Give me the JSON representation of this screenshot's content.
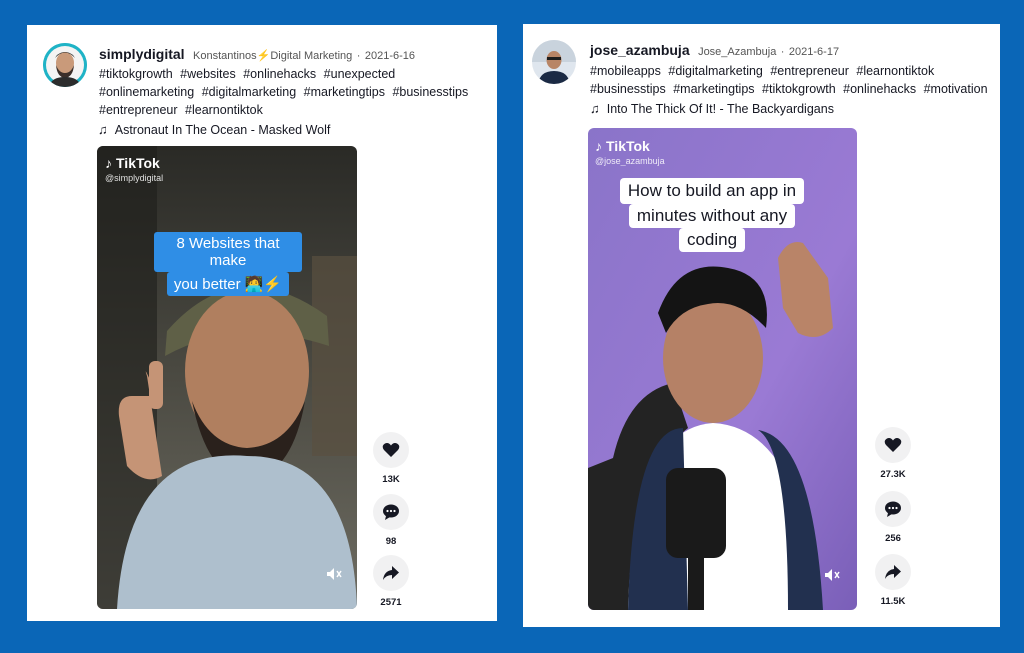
{
  "colors": {
    "frame": "#0a66b7",
    "caption_blue": "#2f8ee6"
  },
  "posts": [
    {
      "username": "simplydigital",
      "display": "Konstantinos",
      "badge": "⚡",
      "role": "Digital Marketing",
      "separator": "·",
      "date": "2021-6-16",
      "hashtags": [
        "#tiktokgrowth",
        "#websites",
        "#onlinehacks",
        "#unexpected",
        "#onlinemarketing",
        "#digitalmarketing",
        "#marketingtips",
        "#businesstips",
        "#entrepreneur",
        "#learnontiktok"
      ],
      "music": "Astronaut In The Ocean - Masked Wolf",
      "watermark": {
        "logo": "TikTok",
        "handle": "@simplydigital"
      },
      "caption": [
        "8 Websites that make",
        "you better 🧑‍💻⚡"
      ],
      "likes": "13K",
      "comments": "98",
      "shares": "2571"
    },
    {
      "username": "jose_azambuja",
      "display": "Jose_Azambuja",
      "separator": "·",
      "date": "2021-6-17",
      "hashtags": [
        "#mobileapps",
        "#digitalmarketing",
        "#entrepreneur",
        "#learnontiktok",
        "#businesstips",
        "#marketingtips",
        "#tiktokgrowth",
        "#onlinehacks",
        "#motivation"
      ],
      "music": "Into The Thick Of It! - The Backyardigans",
      "watermark": {
        "logo": "TikTok",
        "handle": "@jose_azambuja"
      },
      "caption": [
        "How to build an app in",
        "minutes without any",
        "coding"
      ],
      "likes": "27.3K",
      "comments": "256",
      "shares": "11.5K"
    }
  ],
  "icons": {
    "like": "heart-icon",
    "comment": "comment-icon",
    "share": "share-icon",
    "mute": "mute-icon",
    "music": "music-note-icon"
  }
}
